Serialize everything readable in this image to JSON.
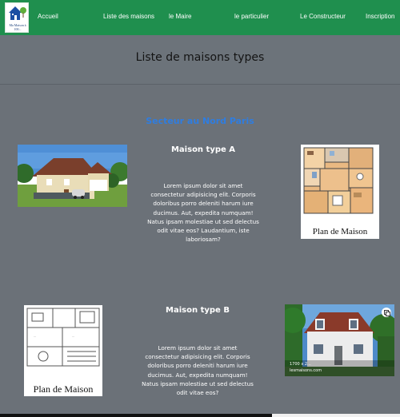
{
  "navbar": {
    "logo_text": "Ma Maison à 100...",
    "items": [
      "Accueil",
      "Liste des maisons",
      "le Maire",
      "le particulier",
      "Le Constructeur",
      "Inscription"
    ]
  },
  "page": {
    "title": "Liste de maisons types"
  },
  "section": {
    "title": "Secteur au Nord Paris"
  },
  "houses": [
    {
      "title": "Maison type A",
      "description": "Lorem ipsum dolor sit amet consectetur adipisicing elit. Corporis doloribus porro deleniti harum iure ducimus. Aut, expedita numquam! Natus ipsam molestiae ut sed delectus odit vitae eos? Laudantium, iste laboriosam?",
      "plan_caption": "Plan de Maison"
    },
    {
      "title": "Maison type B",
      "description": "Lorem ipsum dolor sit amet consectetur adipisicing elit. Corporis doloribus porro deleniti harum iure ducimus. Aut, expedita numquam! Natus ipsam molestiae ut sed delectus odit vitae eos?",
      "plan_caption": "Plan de Maison",
      "photo_size_label": "1700 x 2...",
      "photo_source": "lesmaisons.com"
    }
  ],
  "icons": {
    "expand": "expand-icon",
    "logo": "house-logo-icon"
  },
  "colors": {
    "navbar": "#1f8f4e",
    "background": "#6b7178",
    "section_title": "#2f7de0"
  }
}
